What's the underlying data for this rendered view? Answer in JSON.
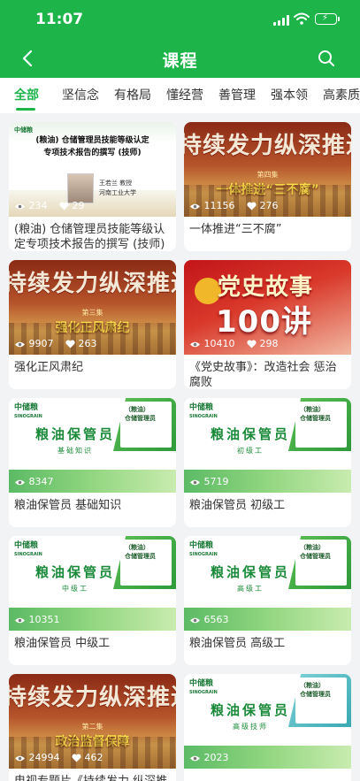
{
  "status_bar": {
    "time": "11:07"
  },
  "nav": {
    "title": "课程"
  },
  "tabs": [
    {
      "label": "全部",
      "active": true
    },
    {
      "label": "坚信念"
    },
    {
      "label": "有格局"
    },
    {
      "label": "懂经营"
    },
    {
      "label": "善管理"
    },
    {
      "label": "强本领"
    },
    {
      "label": "高素质"
    }
  ],
  "colors": {
    "brand_green": "#1db44a"
  },
  "cards": [
    {
      "title": "(粮油) 仓储管理员技能等级认定专项技术报告的撰写 (技师)",
      "views": "234",
      "likes": "29",
      "thumb": {
        "style": "white",
        "heading": "(粮油) 仓储管理员技能等级认定\n专项技术报告的撰写 (技师)",
        "lecturer": "王若兰 教授",
        "school": "河南工业大学"
      }
    },
    {
      "title": "一体推进“三不腐”",
      "views": "11156",
      "likes": "276",
      "thumb": {
        "style": "red",
        "banner": "持续发力纵深推进",
        "episode": "第四集",
        "subtitle": "一体推进“三不腐”"
      }
    },
    {
      "title": "强化正风肃纪",
      "views": "9907",
      "likes": "263",
      "thumb": {
        "style": "red",
        "banner": "持续发力纵深推进",
        "episode": "第三集",
        "subtitle": "强化正风肃纪"
      }
    },
    {
      "title": "《党史故事》：改造社会 惩治腐败",
      "views": "10410",
      "likes": "298",
      "thumb": {
        "style": "party",
        "banner": "党史故事",
        "num": "100讲"
      }
    },
    {
      "title": "粮油保管员 基础知识",
      "views": "8347",
      "likes": "",
      "thumb": {
        "style": "green",
        "logo": "中储粮",
        "logo_en": "SINOGRAIN",
        "word": "粮油保管员",
        "level": "基础知识",
        "box": "（粮油）\n仓储管理员"
      }
    },
    {
      "title": "粮油保管员 初级工",
      "views": "5719",
      "likes": "",
      "thumb": {
        "style": "green",
        "logo": "中储粮",
        "logo_en": "SINOGRAIN",
        "word": "粮油保管员",
        "level": "初级工",
        "box": "（粮油）\n仓储管理员"
      }
    },
    {
      "title": "粮油保管员 中级工",
      "views": "10351",
      "likes": "",
      "thumb": {
        "style": "green",
        "logo": "中储粮",
        "logo_en": "SINOGRAIN",
        "word": "粮油保管员",
        "level": "中级工",
        "box": "（粮油）\n仓储管理员"
      }
    },
    {
      "title": "粮油保管员 高级工",
      "views": "6563",
      "likes": "",
      "thumb": {
        "style": "green",
        "logo": "中储粮",
        "logo_en": "SINOGRAIN",
        "word": "粮油保管员",
        "level": "高级工",
        "box": "（粮油）\n仓储管理员"
      }
    },
    {
      "title": "电视专题片《持续发力 纵深推",
      "views": "24994",
      "likes": "462",
      "thumb": {
        "style": "red",
        "banner": "持续发力纵深推进",
        "episode": "第二集",
        "subtitle": "政治监督保障"
      }
    },
    {
      "title": "",
      "views": "2023",
      "likes": "",
      "thumb": {
        "style": "green-teal",
        "logo": "中储粮",
        "logo_en": "SINOGRAIN",
        "word": "粮油保管员",
        "level": "高级技师",
        "box": "（粮油）\n仓储管理员"
      }
    }
  ]
}
